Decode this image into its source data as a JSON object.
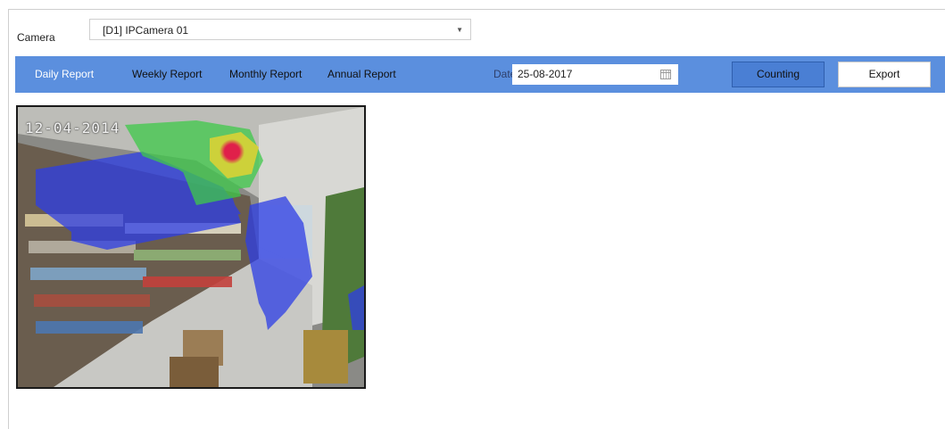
{
  "camera": {
    "label": "Camera",
    "selected": "[D1] IPCamera 01"
  },
  "tabs": [
    {
      "label": "Daily Report",
      "active": true
    },
    {
      "label": "Weekly Report",
      "active": false
    },
    {
      "label": "Monthly Report",
      "active": false
    },
    {
      "label": "Annual Report",
      "active": false
    }
  ],
  "date": {
    "label": "Date",
    "value": "25-08-2017"
  },
  "buttons": {
    "counting": "Counting",
    "export": "Export"
  },
  "video": {
    "timestamp": "12-04-2014"
  },
  "colors": {
    "toolbar": "#5b8fde",
    "counting_button": "#4a7fd4",
    "heat_high": "#e0204a",
    "heat_mid": "#3fc94a",
    "heat_low": "#2d3ee6"
  }
}
